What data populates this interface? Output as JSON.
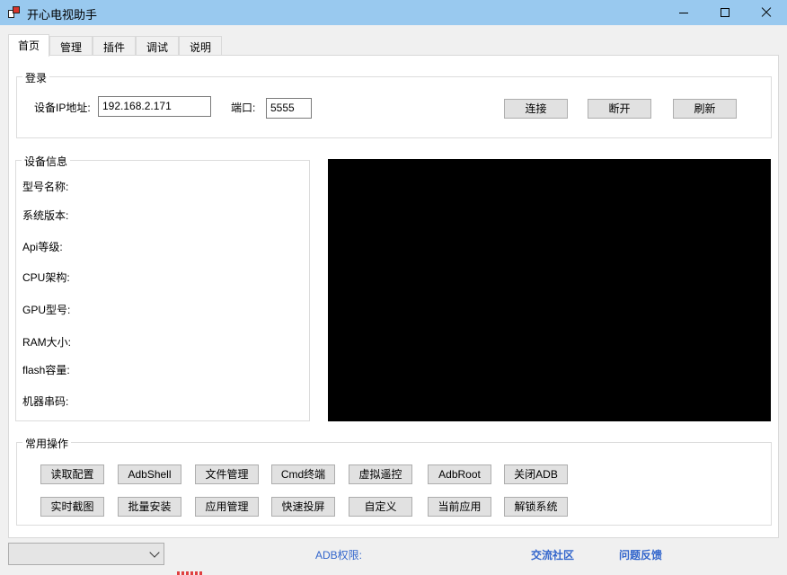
{
  "window": {
    "title": "开心电视助手",
    "app_icon": "app-logo-icon",
    "controls": [
      "minimize-icon",
      "maximize-icon",
      "close-icon"
    ]
  },
  "tabs": [
    {
      "label": "首页",
      "active": true
    },
    {
      "label": "管理",
      "active": false
    },
    {
      "label": "插件",
      "active": false
    },
    {
      "label": "调试",
      "active": false
    },
    {
      "label": "说明",
      "active": false
    }
  ],
  "login": {
    "legend": "登录",
    "ip_label": "设备IP地址:",
    "ip_value": "192.168.2.171",
    "port_label": "端口:",
    "port_value": "5555",
    "connect_label": "连接",
    "disconnect_label": "断开",
    "refresh_label": "刷新"
  },
  "device_info": {
    "legend": "设备信息",
    "fields": [
      {
        "label": "型号名称:"
      },
      {
        "label": "系统版本:"
      },
      {
        "label": "Api等级:"
      },
      {
        "label": "CPU架构:"
      },
      {
        "label": "GPU型号:"
      },
      {
        "label": "RAM大小:"
      },
      {
        "label": "flash容量:"
      },
      {
        "label": "机器串码:"
      }
    ]
  },
  "common_ops": {
    "legend": "常用操作",
    "row1": [
      "读取配置",
      "AdbShell",
      "文件管理",
      "Cmd终端",
      "虚拟遥控",
      "AdbRoot",
      "关闭ADB"
    ],
    "row2": [
      "实时截图",
      "批量安装",
      "应用管理",
      "快速投屏",
      "自定义",
      "当前应用",
      "解锁系统"
    ]
  },
  "statusbar": {
    "adb_permission_label": "ADB权限:",
    "community_link": "交流社区",
    "feedback_link": "问题反馈"
  },
  "colors": {
    "titlebar": "#99c9ef",
    "link": "#3366cc",
    "screen": "#000000"
  }
}
